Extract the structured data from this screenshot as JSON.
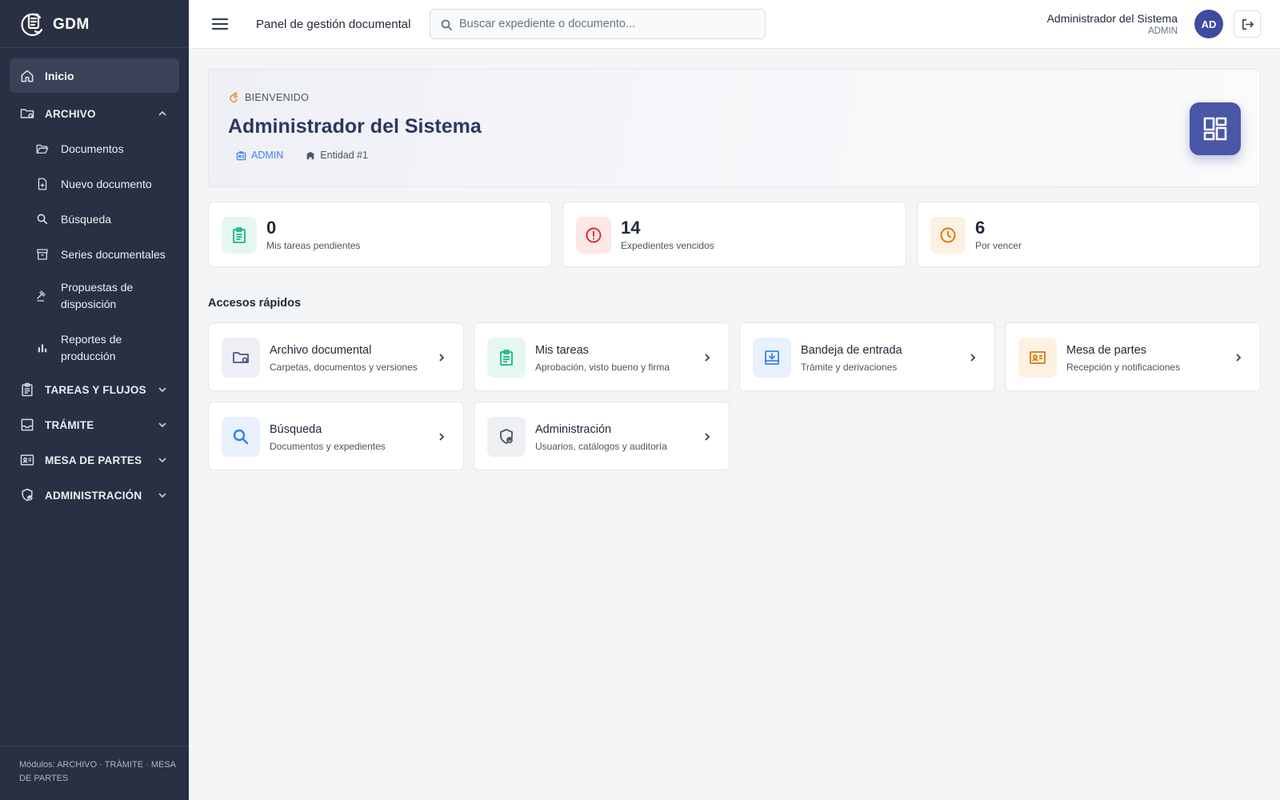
{
  "brand": {
    "name": "GDM"
  },
  "sidebar": {
    "items": [
      {
        "label": "Inicio"
      },
      {
        "label": "ARCHIVO"
      },
      {
        "label": "Documentos"
      },
      {
        "label": "Nuevo documento"
      },
      {
        "label": "Búsqueda"
      },
      {
        "label": "Series documentales"
      },
      {
        "label": "Propuestas de disposición"
      },
      {
        "label": "Reportes de producción"
      },
      {
        "label": "TAREAS Y FLUJOS"
      },
      {
        "label": "TRÁMITE"
      },
      {
        "label": "MESA DE PARTES"
      },
      {
        "label": "ADMINISTRACIÓN"
      }
    ],
    "footer": "Módulos: ARCHIVO · TRÁMITE · MESA DE PARTES"
  },
  "topbar": {
    "title": "Panel de gestión documental",
    "search_placeholder": "Buscar expediente o documento...",
    "user_name": "Administrador del Sistema",
    "user_role": "ADMIN",
    "avatar_initials": "AD"
  },
  "welcome": {
    "tag": "BIENVENIDO",
    "title": "Administrador del Sistema",
    "role": "ADMIN",
    "entity": "Entidad #1"
  },
  "stats": [
    {
      "value": "0",
      "label": "Mis tareas pendientes",
      "color": "#10b981",
      "bg": "#e6f7ef"
    },
    {
      "value": "14",
      "label": "Expedientes vencidos",
      "color": "#dc2626",
      "bg": "#fde8e8"
    },
    {
      "value": "6",
      "label": "Por vencer",
      "color": "#d97706",
      "bg": "#fdf1e2"
    }
  ],
  "quick_access": {
    "title": "Accesos rápidos",
    "items": [
      {
        "title": "Archivo documental",
        "subtitle": "Carpetas, documentos y versiones",
        "color": "#4b5587",
        "bg": "#eeeff6"
      },
      {
        "title": "Mis tareas",
        "subtitle": "Aprobación, visto bueno y firma",
        "color": "#10b981",
        "bg": "#e6f7ef"
      },
      {
        "title": "Bandeja de entrada",
        "subtitle": "Trámite y derivaciones",
        "color": "#3b82f6",
        "bg": "#e8f1fd"
      },
      {
        "title": "Mesa de partes",
        "subtitle": "Recepción y notificaciones",
        "color": "#d97706",
        "bg": "#fdf1e2"
      },
      {
        "title": "Búsqueda",
        "subtitle": "Documentos y expedientes",
        "color": "#2f80ed",
        "bg": "#e8f1fd"
      },
      {
        "title": "Administración",
        "subtitle": "Usuarios, catálogos y auditoría",
        "color": "#4b5563",
        "bg": "#eef0f3"
      }
    ]
  }
}
